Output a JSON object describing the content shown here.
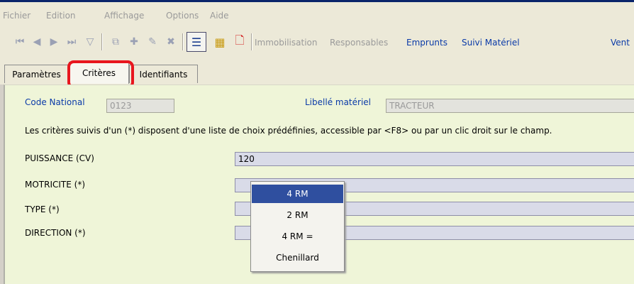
{
  "menu": [
    "Fichier",
    "Edition",
    "Affichage",
    "Options",
    "Aide"
  ],
  "toolbar": {
    "links": [
      {
        "label": "Immobilisation",
        "enabled": false
      },
      {
        "label": "Responsables",
        "enabled": false
      },
      {
        "label": "Emprunts",
        "enabled": true
      },
      {
        "label": "Suivi Matériel",
        "enabled": true
      },
      {
        "label": "Vent",
        "enabled": true
      }
    ]
  },
  "tabs": [
    {
      "label": "Paramètres",
      "active": false
    },
    {
      "label": "Critères",
      "active": true
    },
    {
      "label": "Identifiants",
      "active": false
    }
  ],
  "form": {
    "code_label": "Code National",
    "code_value": "0123",
    "libelle_label": "Libellé matériel",
    "libelle_value": "TRACTEUR",
    "info": "Les critères suivis d'un (*) disposent d'une liste de choix prédéfinies, accessible par <F8> ou par un clic droit sur le champ.",
    "rows": [
      {
        "label": "PUISSANCE (CV)",
        "value": "120"
      },
      {
        "label": "MOTRICITE (*)",
        "value": ""
      },
      {
        "label": "TYPE (*)",
        "value": ""
      },
      {
        "label": "DIRECTION (*)",
        "value": ""
      }
    ]
  },
  "dropdown": {
    "options": [
      "4 RM",
      "2 RM",
      "4 RM =",
      "Chenillard"
    ],
    "selected": "4 RM"
  },
  "colors": {
    "highlight": "#e8161e",
    "link": "#0a3aa8",
    "selection": "#2f4f9f",
    "panel": "#eff5d8"
  }
}
